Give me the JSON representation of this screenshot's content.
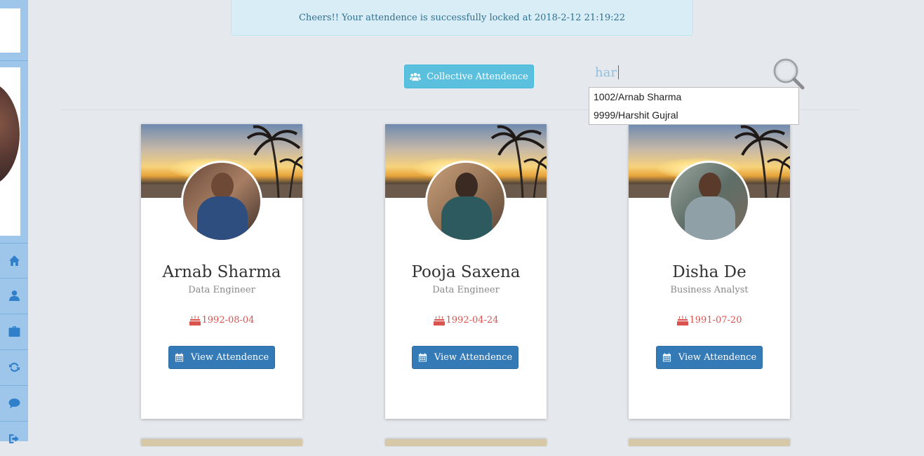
{
  "alert": {
    "message": "Cheers!! Your attendence is successfully locked at 2018-2-12 21:19:22"
  },
  "toolbar": {
    "collective_label": "Collective Attendence"
  },
  "search": {
    "value": "har"
  },
  "autocomplete": {
    "items": [
      "1002/Arnab Sharma",
      "9999/Harshit Gujral"
    ]
  },
  "sidebar": {
    "icons": [
      "home-icon",
      "user-icon",
      "briefcase-icon",
      "refresh-icon",
      "comment-icon",
      "sign-out-icon"
    ]
  },
  "cards": [
    {
      "name": "Arnab Sharma",
      "role": "Data Engineer",
      "dob": "1992-08-04",
      "button": "View Attendence"
    },
    {
      "name": "Pooja Saxena",
      "role": "Data Engineer",
      "dob": "1992-04-24",
      "button": "View Attendence"
    },
    {
      "name": "Disha De",
      "role": "Business Analyst",
      "dob": "1991-07-20",
      "button": "View Attendence"
    }
  ],
  "colors": {
    "primary": "#337ab7",
    "info": "#5bc0de",
    "danger": "#d9534f",
    "alert_bg": "#d9edf7",
    "sidebar": "#9ec6ea"
  }
}
